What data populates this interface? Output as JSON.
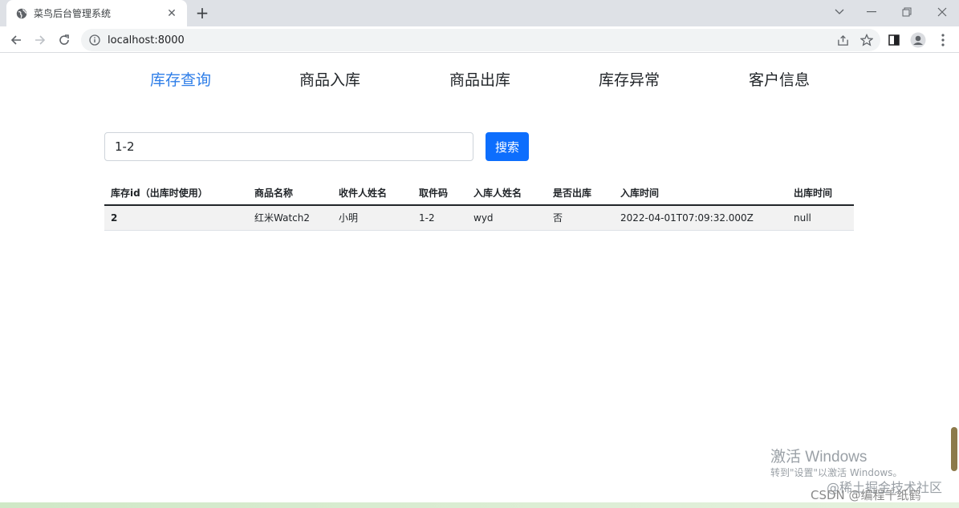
{
  "browser": {
    "tab_title": "菜鸟后台管理系统",
    "url": "localhost:8000"
  },
  "nav": {
    "items": [
      {
        "label": "库存查询",
        "active": true
      },
      {
        "label": "商品入库",
        "active": false
      },
      {
        "label": "商品出库",
        "active": false
      },
      {
        "label": "库存异常",
        "active": false
      },
      {
        "label": "客户信息",
        "active": false
      }
    ]
  },
  "search": {
    "value": "1-2",
    "button_label": "搜索"
  },
  "table": {
    "headers": [
      "库存id（出库时使用）",
      "商品名称",
      "收件人姓名",
      "取件码",
      "入库人姓名",
      "是否出库",
      "入库时间",
      "出库时间"
    ],
    "rows": [
      [
        "2",
        "红米Watch2",
        "小明",
        "1-2",
        "wyd",
        "否",
        "2022-04-01T07:09:32.000Z",
        "null"
      ]
    ]
  },
  "overlay": {
    "activate_title": "激活 Windows",
    "activate_sub": "转到\"设置\"以激活 Windows。",
    "juejin": "@稀土掘金技术社区",
    "csdn": "CSDN @编程千纸鹤"
  },
  "colors": {
    "accent": "#2e7ee8",
    "button": "#0d6efd"
  }
}
